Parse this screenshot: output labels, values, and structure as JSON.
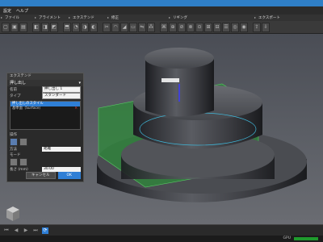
{
  "menu": {
    "items": [
      "設定",
      "ヘルプ"
    ]
  },
  "toolbar_sections": [
    "ファイル",
    "アライメント",
    "エクステンド",
    "修正",
    "リギング",
    "エクスポート"
  ],
  "viewport": {
    "plane_label": "押し出しのスタイル"
  },
  "panel": {
    "title": "エクステンド",
    "header": "押し出し",
    "fields": [
      {
        "label": "名前",
        "value": "押し出し 1"
      },
      {
        "label": "タイプ",
        "value": "スタンダード"
      }
    ],
    "list": [
      {
        "label": "押し出しのスタイル",
        "selected": true,
        "remove": false
      },
      {
        "label": "基準面（Surface）",
        "selected": false,
        "remove": true
      }
    ],
    "operation_label": "操作",
    "method_label": "方法",
    "method_value": "距離",
    "mode_label": "モード",
    "distance_label": "長さ (mm)",
    "distance_value": "30.00",
    "cancel_label": "キャンセル",
    "ok_label": "OK"
  },
  "status": {
    "gpu_label": "GPU"
  },
  "colors": {
    "accent": "#2f7fd6",
    "plane": "#2e8a3a",
    "remove": "#e23a3a"
  }
}
